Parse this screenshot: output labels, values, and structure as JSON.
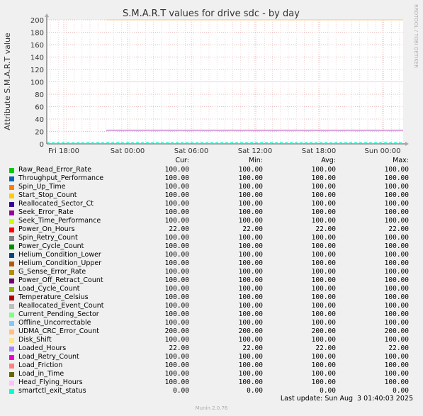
{
  "chart_data": {
    "type": "line",
    "title": "S.M.A.R.T values for drive sdc - by day",
    "ylabel": "Attribute S.M.A.R.T value",
    "ylim": [
      0,
      200
    ],
    "yticks": [
      0,
      20,
      40,
      60,
      80,
      100,
      120,
      140,
      160,
      180,
      200
    ],
    "xticks": [
      "Fri 18:00",
      "Sat 00:00",
      "Sat 06:00",
      "Sat 12:00",
      "Sat 18:00",
      "Sun 00:00"
    ],
    "grid": true,
    "legend_columns": [
      "Cur:",
      "Min:",
      "Avg:",
      "Max:"
    ],
    "series": [
      {
        "name": "Raw_Read_Error_Rate",
        "color": "#00cc00",
        "cur": "100.00",
        "min": "100.00",
        "avg": "100.00",
        "max": "100.00"
      },
      {
        "name": "Throughput_Performance",
        "color": "#0066b3",
        "cur": "100.00",
        "min": "100.00",
        "avg": "100.00",
        "max": "100.00"
      },
      {
        "name": "Spin_Up_Time",
        "color": "#ff8000",
        "cur": "100.00",
        "min": "100.00",
        "avg": "100.00",
        "max": "100.00"
      },
      {
        "name": "Start_Stop_Count",
        "color": "#ffcc00",
        "cur": "100.00",
        "min": "100.00",
        "avg": "100.00",
        "max": "100.00"
      },
      {
        "name": "Reallocated_Sector_Ct",
        "color": "#330099",
        "cur": "100.00",
        "min": "100.00",
        "avg": "100.00",
        "max": "100.00"
      },
      {
        "name": "Seek_Error_Rate",
        "color": "#990099",
        "cur": "100.00",
        "min": "100.00",
        "avg": "100.00",
        "max": "100.00"
      },
      {
        "name": "Seek_Time_Performance",
        "color": "#ccff00",
        "cur": "100.00",
        "min": "100.00",
        "avg": "100.00",
        "max": "100.00"
      },
      {
        "name": "Power_On_Hours",
        "color": "#ff0000",
        "cur": "22.00",
        "min": "22.00",
        "avg": "22.00",
        "max": "22.00"
      },
      {
        "name": "Spin_Retry_Count",
        "color": "#808080",
        "cur": "100.00",
        "min": "100.00",
        "avg": "100.00",
        "max": "100.00"
      },
      {
        "name": "Power_Cycle_Count",
        "color": "#008f00",
        "cur": "100.00",
        "min": "100.00",
        "avg": "100.00",
        "max": "100.00"
      },
      {
        "name": "Helium_Condition_Lower",
        "color": "#00487d",
        "cur": "100.00",
        "min": "100.00",
        "avg": "100.00",
        "max": "100.00"
      },
      {
        "name": "Helium_Condition_Upper",
        "color": "#b35a00",
        "cur": "100.00",
        "min": "100.00",
        "avg": "100.00",
        "max": "100.00"
      },
      {
        "name": "G_Sense_Error_Rate",
        "color": "#b38f00",
        "cur": "100.00",
        "min": "100.00",
        "avg": "100.00",
        "max": "100.00"
      },
      {
        "name": "Power_Off_Retract_Count",
        "color": "#6b006b",
        "cur": "100.00",
        "min": "100.00",
        "avg": "100.00",
        "max": "100.00"
      },
      {
        "name": "Load_Cycle_Count",
        "color": "#8fb300",
        "cur": "100.00",
        "min": "100.00",
        "avg": "100.00",
        "max": "100.00"
      },
      {
        "name": "Temperature_Celsius",
        "color": "#b30000",
        "cur": "100.00",
        "min": "100.00",
        "avg": "100.00",
        "max": "100.00"
      },
      {
        "name": "Reallocated_Event_Count",
        "color": "#bebebe",
        "cur": "100.00",
        "min": "100.00",
        "avg": "100.00",
        "max": "100.00"
      },
      {
        "name": "Current_Pending_Sector",
        "color": "#80ff80",
        "cur": "100.00",
        "min": "100.00",
        "avg": "100.00",
        "max": "100.00"
      },
      {
        "name": "Offline_Uncorrectable",
        "color": "#80c9ff",
        "cur": "100.00",
        "min": "100.00",
        "avg": "100.00",
        "max": "100.00"
      },
      {
        "name": "UDMA_CRC_Error_Count",
        "color": "#ffc080",
        "cur": "200.00",
        "min": "200.00",
        "avg": "200.00",
        "max": "200.00"
      },
      {
        "name": "Disk_Shift",
        "color": "#ffe680",
        "cur": "100.00",
        "min": "100.00",
        "avg": "100.00",
        "max": "100.00"
      },
      {
        "name": "Loaded_Hours",
        "color": "#aa80ff",
        "cur": "22.00",
        "min": "22.00",
        "avg": "22.00",
        "max": "22.00"
      },
      {
        "name": "Load_Retry_Count",
        "color": "#ee00cc",
        "cur": "100.00",
        "min": "100.00",
        "avg": "100.00",
        "max": "100.00"
      },
      {
        "name": "Load_Friction",
        "color": "#ff8080",
        "cur": "100.00",
        "min": "100.00",
        "avg": "100.00",
        "max": "100.00"
      },
      {
        "name": "Load_in_Time",
        "color": "#666600",
        "cur": "100.00",
        "min": "100.00",
        "avg": "100.00",
        "max": "100.00"
      },
      {
        "name": "Head_Flying_Hours",
        "color": "#ffbfff",
        "cur": "100.00",
        "min": "100.00",
        "avg": "100.00",
        "max": "100.00"
      },
      {
        "name": "smartctl_exit_status",
        "color": "#00ffcc",
        "cur": "0.00",
        "min": "0.00",
        "avg": "0.00",
        "max": "0.00"
      }
    ]
  },
  "footer": {
    "last_update": "Last update: Sun Aug  3 01:40:03 2025",
    "version": "Munin 2.0.76",
    "side_tag": "RRDTOOL / TOBI OETIKER"
  }
}
